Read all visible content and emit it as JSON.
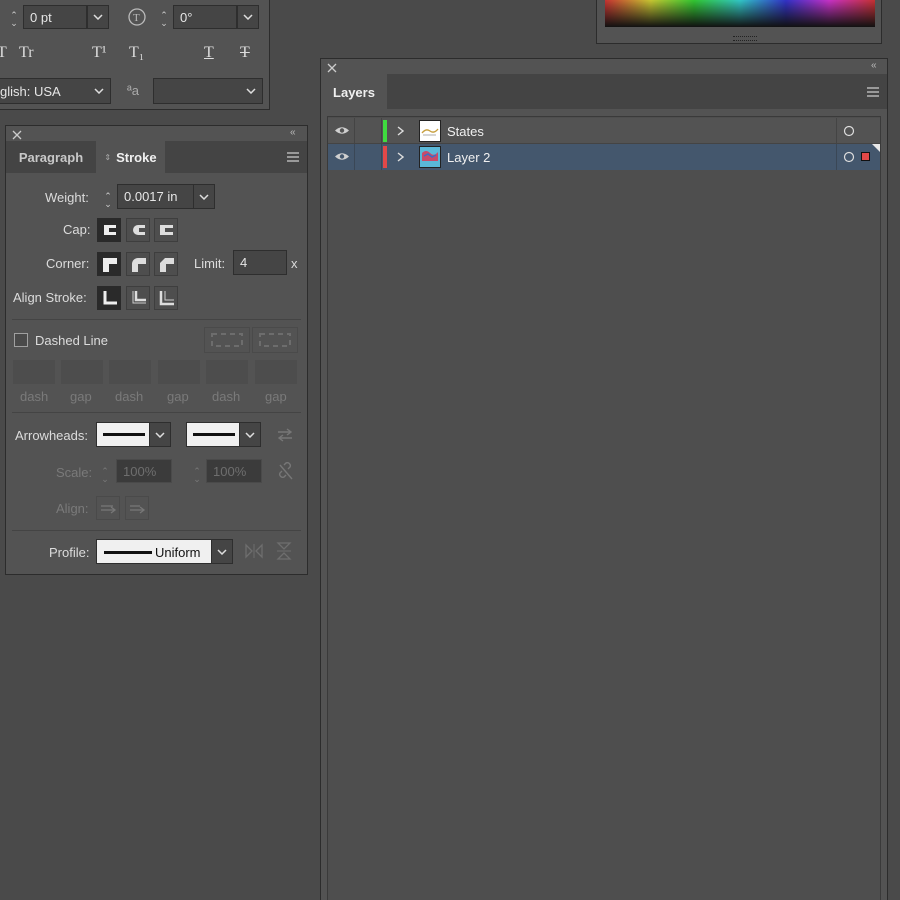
{
  "colors": {
    "panel": "#535353",
    "background": "#4a4a4a",
    "selected_row": "#44576d",
    "states_layer": "#3fdc3f",
    "layer2": "#e24848"
  },
  "character": {
    "tracking_value": "0 pt",
    "rotation_value": "0°",
    "language": "glish: USA",
    "style_labels": [
      "Tr",
      "T¹",
      "T₁",
      "T",
      "T"
    ]
  },
  "stroke_panel": {
    "tabs": [
      "Paragraph",
      "Stroke"
    ],
    "weight_label": "Weight:",
    "weight_value": "0.0017 in",
    "cap_label": "Cap:",
    "corner_label": "Corner:",
    "limit_label": "Limit:",
    "limit_value": "4",
    "limit_unit": "x",
    "align_label": "Align Stroke:",
    "dashed_label": "Dashed Line",
    "dash_labels": [
      "dash",
      "gap",
      "dash",
      "gap",
      "dash",
      "gap"
    ],
    "arrowheads_label": "Arrowheads:",
    "scale_label": "Scale:",
    "scale_value_1": "100%",
    "scale_value_2": "100%",
    "align_label2": "Align:",
    "profile_label": "Profile:",
    "profile_value": "Uniform"
  },
  "layers_panel": {
    "title": "Layers",
    "layers": [
      {
        "name": "States",
        "selected": false
      },
      {
        "name": "Layer 2",
        "selected": true
      }
    ]
  }
}
